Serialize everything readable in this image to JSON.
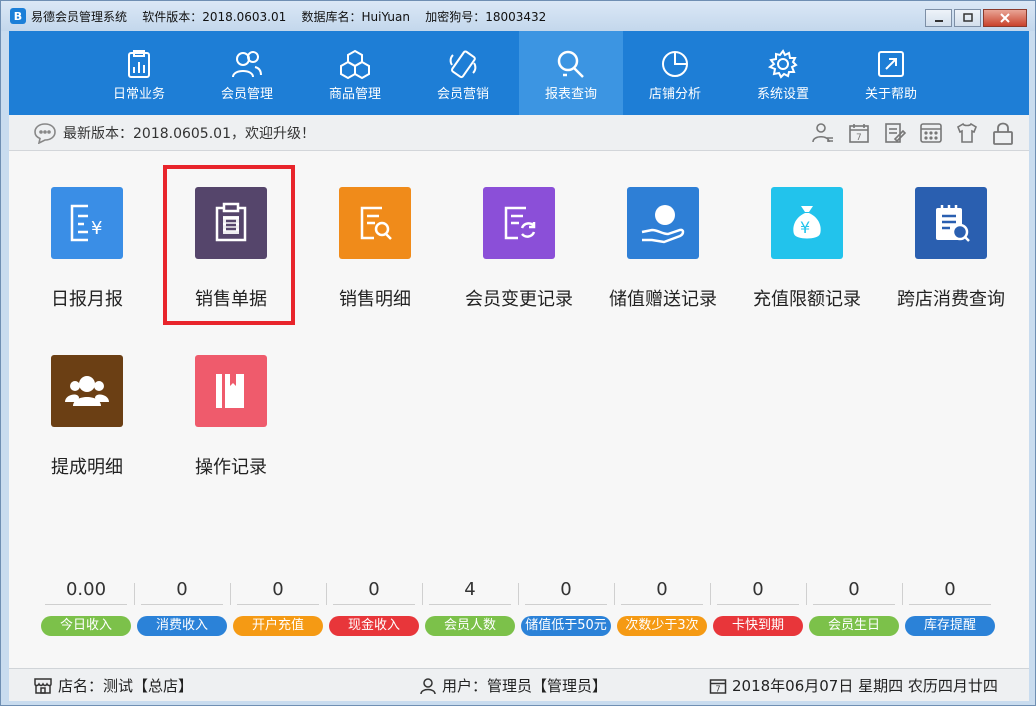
{
  "window": {
    "title": "易德会员管理系统    软件版本：2018.0603.01    数据库名：HuiYuan    加密狗号：18003432",
    "app_icon_letter": "B"
  },
  "nav": [
    {
      "label": "日常业务",
      "icon": "clipboard-chart-icon"
    },
    {
      "label": "会员管理",
      "icon": "users-icon"
    },
    {
      "label": "商品管理",
      "icon": "cubes-icon"
    },
    {
      "label": "会员营销",
      "icon": "phone-icon"
    },
    {
      "label": "报表查询",
      "icon": "search-report-icon",
      "active": true
    },
    {
      "label": "店铺分析",
      "icon": "pie-chart-icon"
    },
    {
      "label": "系统设置",
      "icon": "gear-icon"
    },
    {
      "label": "关于帮助",
      "icon": "help-icon"
    }
  ],
  "info": {
    "text": "最新版本：2018.0605.01，欢迎升级！"
  },
  "tiles": [
    {
      "label": "日报月报",
      "color": "#3a8ee6",
      "icon": "daily-report-icon"
    },
    {
      "label": "销售单据",
      "color": "#55456b",
      "icon": "sales-doc-icon",
      "highlighted": true
    },
    {
      "label": "销售明细",
      "color": "#f08b1a",
      "icon": "sales-detail-icon"
    },
    {
      "label": "会员变更记录",
      "color": "#8b4fd8",
      "icon": "member-change-icon"
    },
    {
      "label": "储值赠送记录",
      "color": "#2e7fd6",
      "icon": "stored-value-gift-icon"
    },
    {
      "label": "充值限额记录",
      "color": "#22c3ec",
      "icon": "money-bag-icon"
    },
    {
      "label": "跨店消费查询",
      "color": "#2a5fb0",
      "icon": "cross-store-query-icon"
    },
    {
      "label": "提成明细",
      "color": "#6b3f14",
      "icon": "commission-icon"
    },
    {
      "label": "操作记录",
      "color": "#ef5b6c",
      "icon": "operation-log-icon"
    }
  ],
  "stats": [
    {
      "value": "0.00",
      "label": "今日收入",
      "color": "#7cc14a"
    },
    {
      "value": "0",
      "label": "消费收入",
      "color": "#2b82d8"
    },
    {
      "value": "0",
      "label": "开户充值",
      "color": "#f59a14"
    },
    {
      "value": "0",
      "label": "现金收入",
      "color": "#e8363a"
    },
    {
      "value": "4",
      "label": "会员人数",
      "color": "#7cc14a"
    },
    {
      "value": "0",
      "label": "储值低于50元",
      "color": "#2b82d8"
    },
    {
      "value": "0",
      "label": "次数少于3次",
      "color": "#f59a14"
    },
    {
      "value": "0",
      "label": "卡快到期",
      "color": "#e8363a"
    },
    {
      "value": "0",
      "label": "会员生日",
      "color": "#7cc14a"
    },
    {
      "value": "0",
      "label": "库存提醒",
      "color": "#2b82d8"
    }
  ],
  "status": {
    "store": "店名：测试【总店】",
    "user": "用户：管理员【管理员】",
    "date": "2018年06月07日 星期四 农历四月廿四"
  }
}
